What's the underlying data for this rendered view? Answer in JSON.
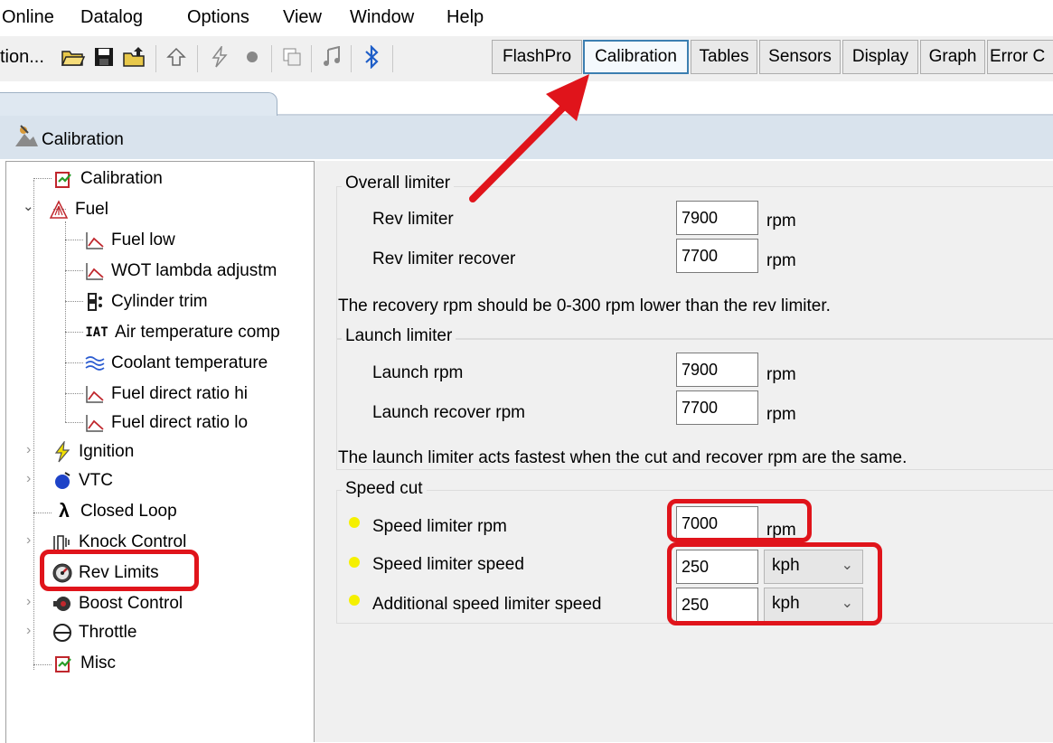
{
  "menu": [
    "Online",
    "Datalog",
    "Options",
    "View",
    "Window",
    "Help"
  ],
  "toolbar": {
    "first_label": "tion...",
    "icons": [
      "open-folder-icon",
      "save-icon",
      "upload-icon",
      "up-arrow-icon",
      "flash-icon",
      "record-icon",
      "copy-icon",
      "audio-icon",
      "bluetooth-icon"
    ],
    "tabs": [
      "FlashPro",
      "Calibration",
      "Tables",
      "Sensors",
      "Display",
      "Graph",
      "Error C"
    ]
  },
  "panel": {
    "title": "Calibration"
  },
  "tree": {
    "items": [
      {
        "label": "Calibration",
        "icon": "calibration-icon"
      },
      {
        "label": "Fuel",
        "icon": "fuel-icon"
      },
      {
        "label": "Fuel low",
        "icon": "graph-icon"
      },
      {
        "label": "WOT lambda adjustm",
        "icon": "graph-icon"
      },
      {
        "label": "Cylinder trim",
        "icon": "cylinder-icon"
      },
      {
        "label": "Air temperature comp",
        "icon": "iat-icon",
        "icon_text": "IAT"
      },
      {
        "label": "Coolant temperature",
        "icon": "coolant-icon"
      },
      {
        "label": "Fuel direct ratio hi",
        "icon": "graph-icon"
      },
      {
        "label": "Fuel direct ratio lo",
        "icon": "graph-icon"
      },
      {
        "label": "Ignition",
        "icon": "ignition-icon"
      },
      {
        "label": "VTC",
        "icon": "vtc-icon"
      },
      {
        "label": "Closed Loop",
        "icon": "lambda-icon",
        "icon_text": "λ"
      },
      {
        "label": "Knock Control",
        "icon": "knock-icon"
      },
      {
        "label": "Rev Limits",
        "icon": "rev-limits-icon"
      },
      {
        "label": "Boost Control",
        "icon": "boost-icon"
      },
      {
        "label": "Throttle",
        "icon": "throttle-icon"
      },
      {
        "label": "Misc",
        "icon": "misc-icon"
      }
    ]
  },
  "overall": {
    "title": "Overall limiter",
    "rev_label": "Rev limiter",
    "rev_value": "7900",
    "rev_unit": "rpm",
    "recover_label": "Rev limiter recover",
    "recover_value": "7700",
    "recover_unit": "rpm",
    "note": "The recovery rpm should be 0-300 rpm lower than the rev limiter."
  },
  "launch": {
    "title": "Launch limiter",
    "rpm_label": "Launch rpm",
    "rpm_value": "7900",
    "rpm_unit": "rpm",
    "recover_label": "Launch recover rpm",
    "recover_value": "7700",
    "recover_unit": "rpm",
    "note": "The launch limiter acts fastest when the cut and recover rpm are the same."
  },
  "speed": {
    "title": "Speed cut",
    "rpm_label": "Speed limiter rpm",
    "rpm_value": "7000",
    "rpm_unit": "rpm",
    "speed_label": "Speed limiter speed",
    "speed_value": "250",
    "speed_unit": "kph",
    "add_label": "Additional speed limiter speed",
    "add_value": "250",
    "add_unit": "kph"
  },
  "colors": {
    "highlight": "#e0141b",
    "panel_header": "#d9e3ed",
    "marker_dot": "#f5f000"
  }
}
